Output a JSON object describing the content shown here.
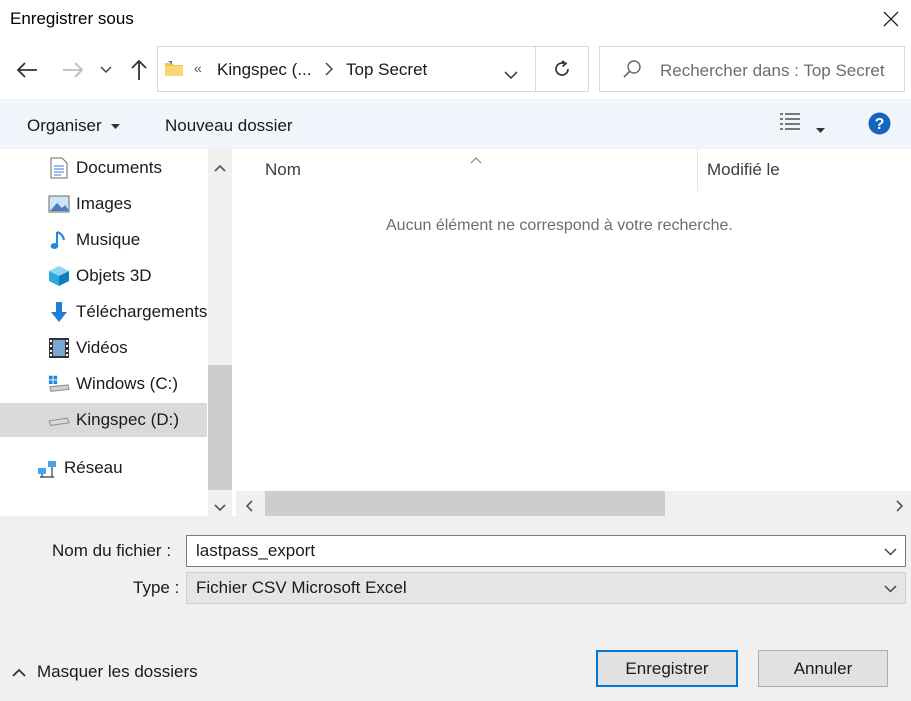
{
  "window": {
    "title": "Enregistrer sous"
  },
  "address": {
    "overflow": "«",
    "crumbs": [
      "Kingspec (...",
      "Top Secret"
    ]
  },
  "search": {
    "placeholder": "Rechercher dans : Top Secret"
  },
  "toolbar": {
    "organize": "Organiser",
    "new_folder": "Nouveau dossier"
  },
  "sidebar": {
    "items": [
      {
        "label": "Documents",
        "icon": "documents-icon"
      },
      {
        "label": "Images",
        "icon": "images-icon"
      },
      {
        "label": "Musique",
        "icon": "music-icon"
      },
      {
        "label": "Objets 3D",
        "icon": "3d-objects-icon"
      },
      {
        "label": "Téléchargements",
        "icon": "downloads-icon"
      },
      {
        "label": "Vidéos",
        "icon": "videos-icon"
      },
      {
        "label": "Windows (C:)",
        "icon": "drive-c-icon"
      },
      {
        "label": "Kingspec (D:)",
        "icon": "drive-d-icon",
        "selected": true
      },
      {
        "label": "Réseau",
        "icon": "network-icon"
      }
    ]
  },
  "file_list": {
    "columns": [
      "Nom",
      "Modifié le"
    ],
    "empty_message": "Aucun élément ne correspond à votre recherche."
  },
  "form": {
    "filename_label": "Nom du fichier :",
    "filename_value": "lastpass_export",
    "type_label": "Type :",
    "type_value": "Fichier CSV Microsoft Excel"
  },
  "footer": {
    "hide_folders": "Masquer les dossiers",
    "save": "Enregistrer",
    "cancel": "Annuler"
  },
  "colors": {
    "accent": "#0078d7",
    "toolbar_bg": "#f0f5fb",
    "selected_bg": "#d9d9d9",
    "help": "#1565c0"
  }
}
